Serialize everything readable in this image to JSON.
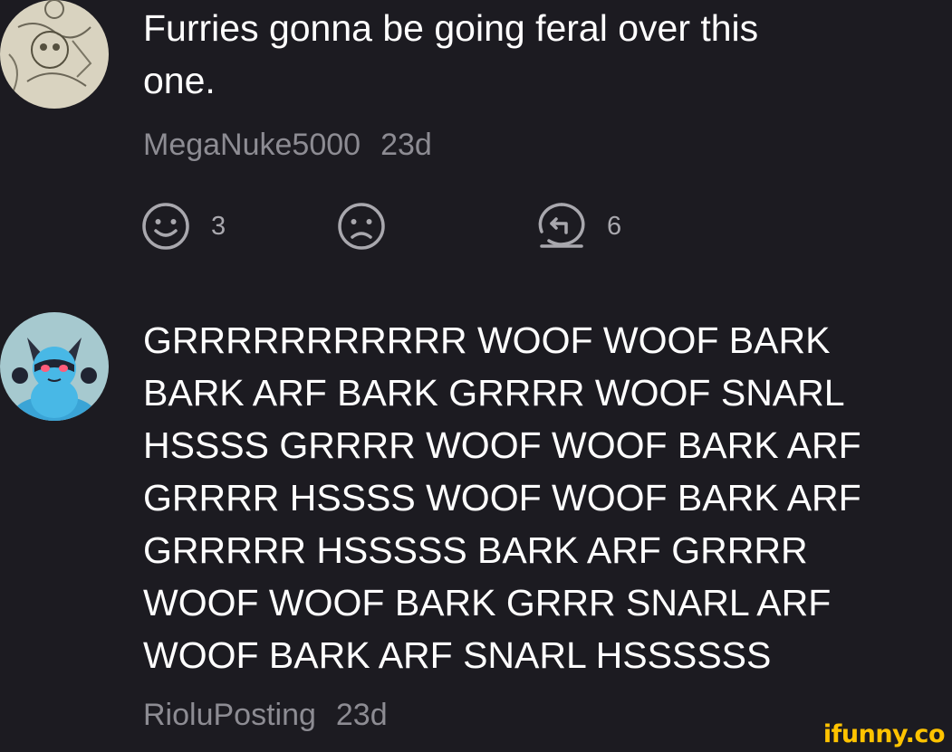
{
  "comments": [
    {
      "avatar_icon": "sketch-drawing-avatar",
      "text": "Furries gonna be going feral over this\none.",
      "username": "MegaNuke5000",
      "time": "23d",
      "actions": {
        "smile_icon": "smile-face-icon",
        "smile_count": "3",
        "frown_icon": "frown-face-icon",
        "reply_icon": "reply-bubble-icon",
        "reply_count": "6"
      }
    },
    {
      "avatar_icon": "riolu-avatar",
      "text": "GRRRRRRRRRRR WOOF WOOF BARK\nBARK ARF BARK GRRRR WOOF SNARL\nHSSSS GRRRR WOOF WOOF BARK ARF\nGRRRR HSSSS WOOF WOOF BARK ARF\nGRRRRR HSSSSS BARK ARF GRRRR\nWOOF WOOF BARK GRRR SNARL ARF\nWOOF BARK ARF SNARL HSSSSSS",
      "username": "RioluPosting",
      "time": "23d"
    }
  ],
  "watermark": "ifunny.co",
  "colors": {
    "background": "#1c1b21",
    "text": "#ffffff",
    "meta": "#8d8c93",
    "icon": "#a9a8ae",
    "watermark": "#ffc300"
  }
}
